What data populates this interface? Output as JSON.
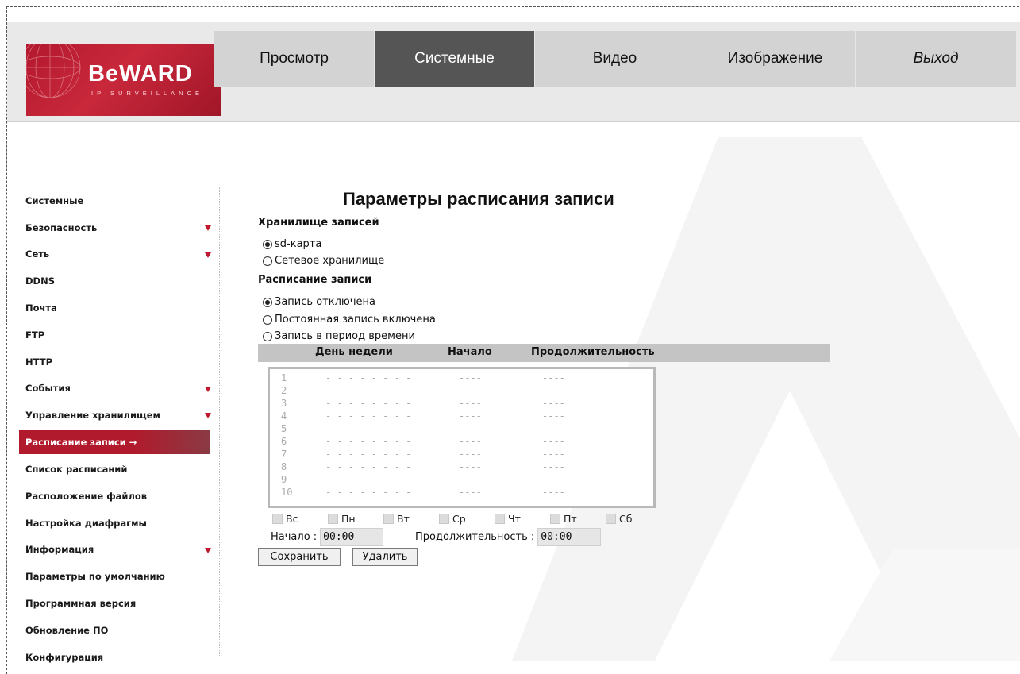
{
  "brand": {
    "logo_text": "BeWARD",
    "logo_sub": "IP SURVEILLANCE"
  },
  "nav": {
    "tabs": [
      {
        "label": "Просмотр",
        "active": false
      },
      {
        "label": "Системные",
        "active": true
      },
      {
        "label": "Видео",
        "active": false
      },
      {
        "label": "Изображение",
        "active": false
      },
      {
        "label": "Выход",
        "active": false
      }
    ]
  },
  "sidebar": {
    "items": [
      {
        "label": "Системные",
        "expandable": false
      },
      {
        "label": "Безопасность",
        "expandable": true
      },
      {
        "label": "Сеть",
        "expandable": true
      },
      {
        "label": "DDNS",
        "expandable": false
      },
      {
        "label": "Почта",
        "expandable": false
      },
      {
        "label": "FTP",
        "expandable": false
      },
      {
        "label": "HTTP",
        "expandable": false
      },
      {
        "label": "События",
        "expandable": true
      },
      {
        "label": "Управление хранилищем",
        "expandable": true
      },
      {
        "label": "Расписание записи →",
        "expandable": false,
        "active": true
      },
      {
        "label": "Список расписаний",
        "expandable": false
      },
      {
        "label": "Расположение файлов",
        "expandable": false
      },
      {
        "label": "Настройка диафрагмы",
        "expandable": false
      },
      {
        "label": "Информация",
        "expandable": true
      },
      {
        "label": "Параметры по умолчанию",
        "expandable": false
      },
      {
        "label": "Программная версия",
        "expandable": false
      },
      {
        "label": "Обновление ПО",
        "expandable": false
      },
      {
        "label": "Конфигурация",
        "expandable": false
      }
    ]
  },
  "main": {
    "title": "Параметры расписания записи",
    "storage": {
      "heading": "Хранилище записей",
      "options": [
        {
          "label": "sd-карта",
          "checked": true
        },
        {
          "label": "Сетевое хранилище",
          "checked": false
        }
      ]
    },
    "schedule": {
      "heading": "Расписание записи",
      "options": [
        {
          "label": "Запись отключена",
          "checked": true
        },
        {
          "label": "Постоянная запись включена",
          "checked": false
        },
        {
          "label": "Запись в период времени",
          "checked": false
        }
      ],
      "columns": [
        "День недели",
        "Начало",
        "Продолжительность"
      ],
      "rows": [
        {
          "n": "1",
          "days": "- - - - - - - -",
          "start": "----",
          "dur": "----"
        },
        {
          "n": "2",
          "days": "- - - - - - - -",
          "start": "----",
          "dur": "----"
        },
        {
          "n": "3",
          "days": "- - - - - - - -",
          "start": "----",
          "dur": "----"
        },
        {
          "n": "4",
          "days": "- - - - - - - -",
          "start": "----",
          "dur": "----"
        },
        {
          "n": "5",
          "days": "- - - - - - - -",
          "start": "----",
          "dur": "----"
        },
        {
          "n": "6",
          "days": "- - - - - - - -",
          "start": "----",
          "dur": "----"
        },
        {
          "n": "7",
          "days": "- - - - - - - -",
          "start": "----",
          "dur": "----"
        },
        {
          "n": "8",
          "days": "- - - - - - - -",
          "start": "----",
          "dur": "----"
        },
        {
          "n": "9",
          "days": "- - - - - - - -",
          "start": "----",
          "dur": "----"
        },
        {
          "n": "10",
          "days": "- - - - - - - -",
          "start": "----",
          "dur": "----"
        }
      ],
      "days": [
        "Вс",
        "Пн",
        "Вт",
        "Ср",
        "Чт",
        "Пт",
        "Сб"
      ],
      "start_label": "Начало :",
      "start_value": "00:00",
      "duration_label": "Продолжительность :",
      "duration_value": "00:00",
      "save_label": "Сохранить",
      "delete_label": "Удалить"
    }
  },
  "colors": {
    "brand_red": "#b3182e",
    "nav_active": "#555555",
    "nav_bg": "#d3d3d3"
  }
}
